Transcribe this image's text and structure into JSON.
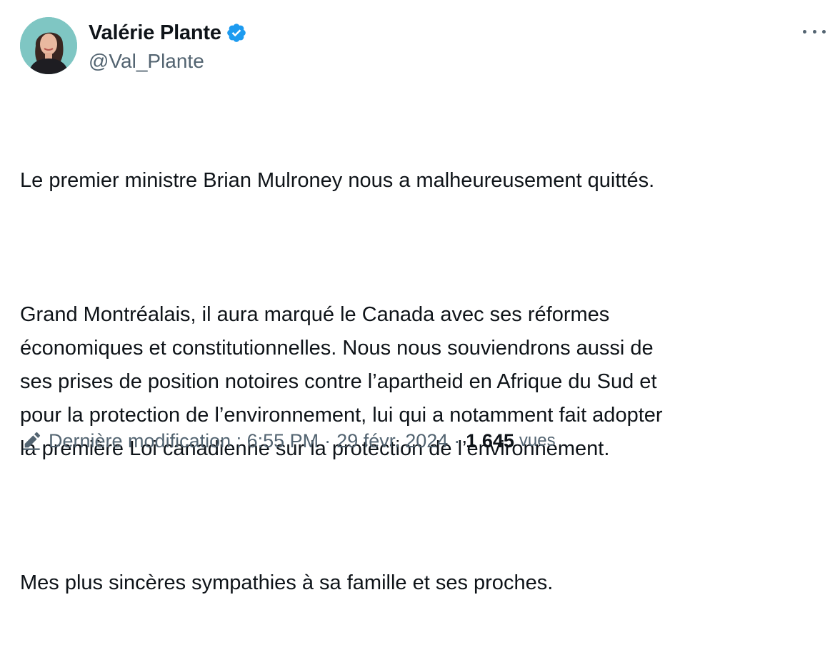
{
  "author": {
    "display_name": "Valérie Plante",
    "handle": "@Val_Plante",
    "verified_icon": "verified-badge-icon",
    "badge_color": "#1d9bf0"
  },
  "tweet": {
    "paragraphs": [
      "Le premier ministre Brian Mulroney nous a malheureusement quittés.",
      "Grand Montréalais, il aura marqué le Canada avec ses réformes\néconomiques et constitutionnelles. Nous nous souviendrons aussi de\nses prises de position notoires contre l’apartheid en Afrique du Sud et\npour la protection de l’environnement, lui qui a notamment fait adopter\nla première Loi canadienne sur la protection de l’environnement.",
      "Mes plus sincères sympathies à sa famille et ses proches."
    ]
  },
  "meta": {
    "edit_icon": "pencil-icon",
    "edited_label": "Dernière modification : 6:55 PM",
    "separator": "·",
    "date": "29 févr. 2024",
    "views_count": "1 645",
    "views_label": "vues"
  },
  "colors": {
    "text_primary": "#0f1419",
    "text_secondary": "#536471",
    "accent": "#1d9bf0"
  }
}
